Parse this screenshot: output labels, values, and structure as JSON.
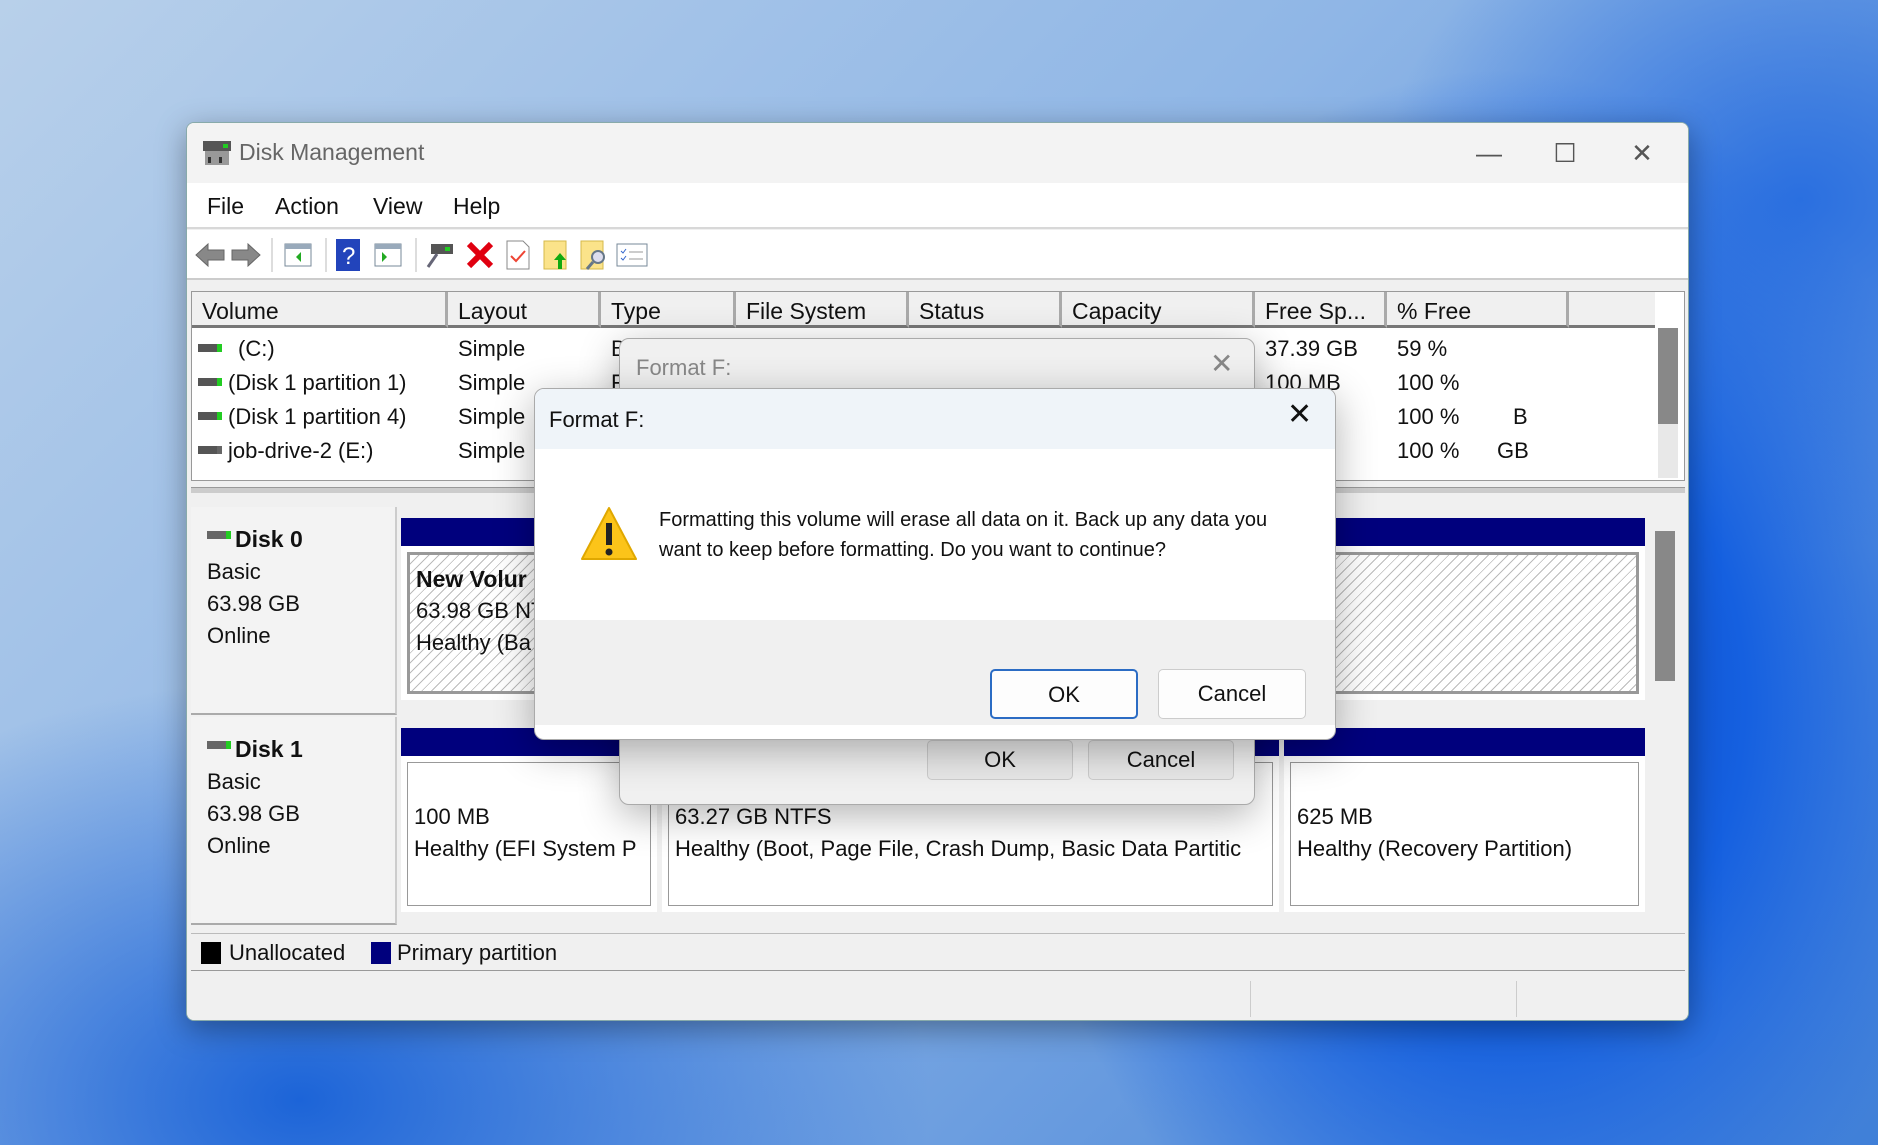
{
  "window": {
    "title": "Disk Management",
    "minimize": "—",
    "maximize": "☐",
    "close": "✕"
  },
  "menu": [
    "File",
    "Action",
    "View",
    "Help"
  ],
  "toolbar": [
    "back-icon",
    "forward-icon",
    "console-tree-icon",
    "help-icon",
    "action-pane-icon",
    "connect-disk-icon",
    "delete-icon",
    "check-icon",
    "folder-up-icon",
    "folder-search-icon",
    "properties-list-icon"
  ],
  "table": {
    "headers": [
      "Volume",
      "Layout",
      "Type",
      "File System",
      "Status",
      "Capacity",
      "Free Sp...",
      "% Free"
    ],
    "rows": [
      {
        "volume": "(C:)",
        "layout": "Simple",
        "type": "B",
        "free": "37.39 GB",
        "pct": "59 %"
      },
      {
        "volume": "(Disk 1 partition 1)",
        "layout": "Simple",
        "type": "F",
        "free": "100 MB",
        "pct": "100 %"
      },
      {
        "volume": "(Disk 1 partition 4)",
        "layout": "Simple",
        "type": "",
        "free": "B",
        "pct": "100 %"
      },
      {
        "volume": "job-drive-2 (E:)",
        "layout": "Simple",
        "type": "",
        "free": "GB",
        "pct": "100 %"
      }
    ]
  },
  "disks": [
    {
      "name": "Disk 0",
      "type": "Basic",
      "size": "63.98 GB",
      "state": "Online",
      "partitions": [
        {
          "name": "New Volur",
          "size": "63.98 GB NT",
          "status": "Healthy (Ba"
        }
      ]
    },
    {
      "name": "Disk 1",
      "type": "Basic",
      "size": "63.98 GB",
      "state": "Online",
      "partitions": [
        {
          "size": "100 MB",
          "status": "Healthy (EFI System P"
        },
        {
          "size": "63.27 GB NTFS",
          "status": "Healthy (Boot, Page File, Crash Dump, Basic Data Partitic"
        },
        {
          "size": "625 MB",
          "status": "Healthy (Recovery Partition)"
        }
      ]
    }
  ],
  "legend": [
    {
      "label": "Unallocated",
      "color": "#000000"
    },
    {
      "label": "Primary partition",
      "color": "#00007d"
    }
  ],
  "back_dialog": {
    "title": "Format F:",
    "ok": "OK",
    "cancel": "Cancel"
  },
  "dialog": {
    "title": "Format F:",
    "message_line1": "Formatting this volume will erase all data on it. Back up any data you",
    "message_line2": "want to keep before formatting. Do you want to continue?",
    "ok": "OK",
    "cancel": "Cancel",
    "icon": "warning-icon"
  }
}
